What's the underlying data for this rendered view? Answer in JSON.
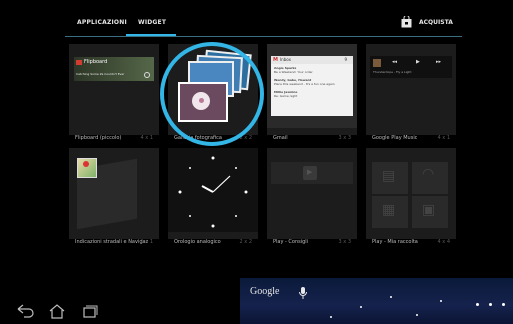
{
  "tabs": {
    "apps": "APPLICAZIONI",
    "widget": "WIDGET"
  },
  "shop": {
    "label": "ACQUISTA"
  },
  "widgets": [
    {
      "name": "Flipboard (piccolo)",
      "dims": "4 x 1"
    },
    {
      "name": "Galleria fotografica",
      "dims": "2 x 2"
    },
    {
      "name": "Gmail",
      "dims": "3 x 3"
    },
    {
      "name": "Google Play Music",
      "dims": "4 x 1"
    },
    {
      "name": "Indicazioni stradali e Navigaz",
      "dims": "1 x 1"
    },
    {
      "name": "Orologio analogico",
      "dims": "2 x 2"
    },
    {
      "name": "Play - Consigli",
      "dims": "3 x 3"
    },
    {
      "name": "Play - Mia raccolta",
      "dims": "4 x 4"
    }
  ],
  "previews": {
    "flipboard_logo": "Flipboard",
    "flipboard_caption": "Catching Some Zs Couldn't Ever",
    "gmail_header": "Inbox",
    "gmail_count": "9",
    "gmail_rows": [
      {
        "from": "Angie Sparks",
        "text": "Be a Weekend: Your order"
      },
      {
        "from": "Wendy, Gabe, Howard",
        "text": "Plans this weekend - It's a fun one again"
      },
      {
        "from": "Millie Jasmine",
        "text": "Re: Game night"
      }
    ],
    "music_track": "Thunderdope - Fly a Light"
  },
  "wallpaper": {
    "google": "Google"
  },
  "colors": {
    "accent": "#33b5e5",
    "tile": "#1c1c1c"
  },
  "icons": {
    "back": "back-icon",
    "home": "home-icon",
    "recent": "recent-apps-icon",
    "shop": "shopping-bag-icon",
    "mic": "microphone-icon"
  }
}
